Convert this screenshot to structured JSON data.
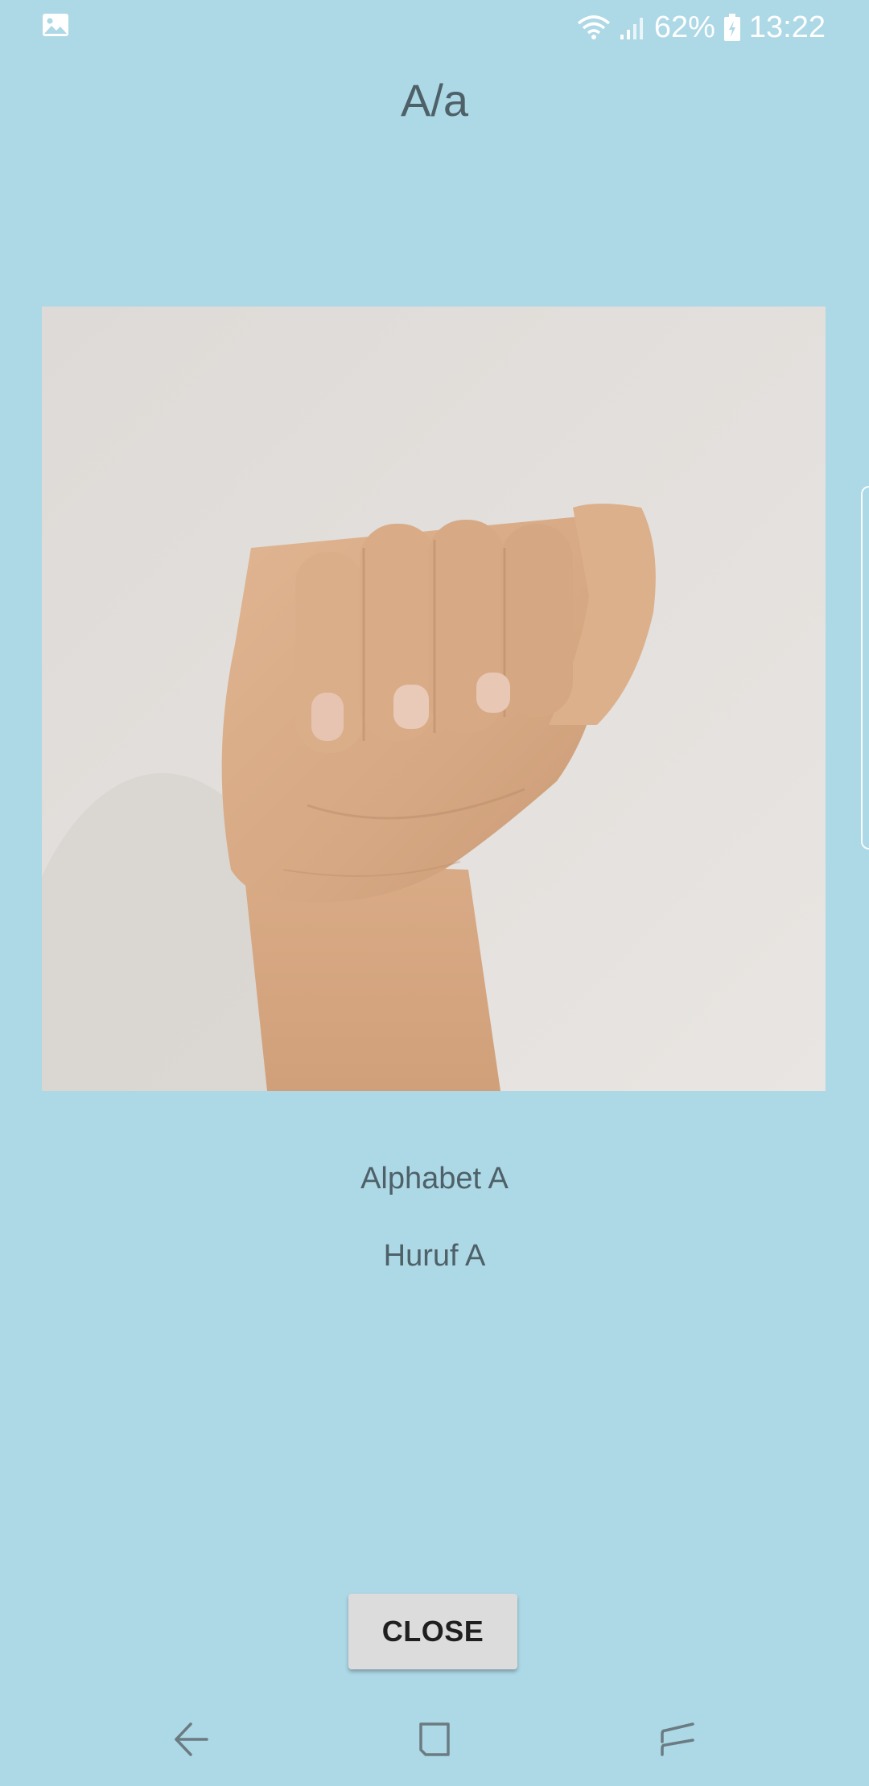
{
  "status_bar": {
    "left_icon": "image-icon",
    "battery_percent": "62%",
    "time": "13:22",
    "icons": [
      "wifi-icon",
      "signal-icon",
      "battery-charging-icon"
    ]
  },
  "title": "A/a",
  "image": {
    "icon": "hand-sign-photo"
  },
  "captions": {
    "english": "Alphabet A",
    "malay": "Huruf A"
  },
  "close_button": {
    "label": "CLOSE"
  },
  "nav_bar": {
    "icons": [
      "back-icon",
      "home-icon",
      "recent-apps-icon"
    ]
  },
  "colors": {
    "background": "#add8e6",
    "text": "#4e6168",
    "button": "#dcdcdc"
  }
}
